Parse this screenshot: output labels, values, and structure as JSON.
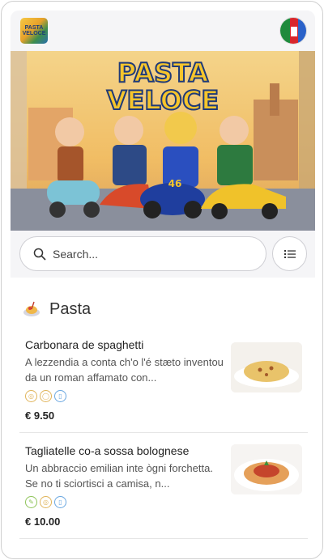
{
  "header": {
    "logo_text": "PASTA VELOCE",
    "logo_icon": "restaurant-logo",
    "language_icon": "flag-icon"
  },
  "hero": {
    "title_line1": "PASTA",
    "title_line2": "VELOCE",
    "rider_number": "46",
    "colors": {
      "sky": "#f3c874",
      "title": "#f6c52b",
      "title_outline": "#1f3a78"
    }
  },
  "search": {
    "placeholder": "Search...",
    "icon": "search-icon",
    "filter_icon": "list-icon"
  },
  "category": {
    "name": "Pasta",
    "icon": "pasta-plate-icon"
  },
  "items": [
    {
      "name": "Carbonara de spaghetti",
      "description": "A lezzendia a conta ch'o l'é stæto inventou da un roman affamato con...",
      "price": "€ 9.50",
      "allergens": [
        {
          "icon": "gluten-icon",
          "color": "#e0b45a"
        },
        {
          "icon": "egg-icon",
          "color": "#e0b45a"
        },
        {
          "icon": "milk-icon",
          "color": "#6aa7e0"
        }
      ]
    },
    {
      "name": "Tagliatelle co-a sossa bolognese",
      "description": "Un abbraccio emilian inte ògni forchetta. Se no ti sciortisci a camisa, n...",
      "price": "€ 10.00",
      "allergens": [
        {
          "icon": "celery-icon",
          "color": "#8fc45a"
        },
        {
          "icon": "gluten-icon",
          "color": "#e0b45a"
        },
        {
          "icon": "milk-icon",
          "color": "#6aa7e0"
        }
      ]
    }
  ]
}
